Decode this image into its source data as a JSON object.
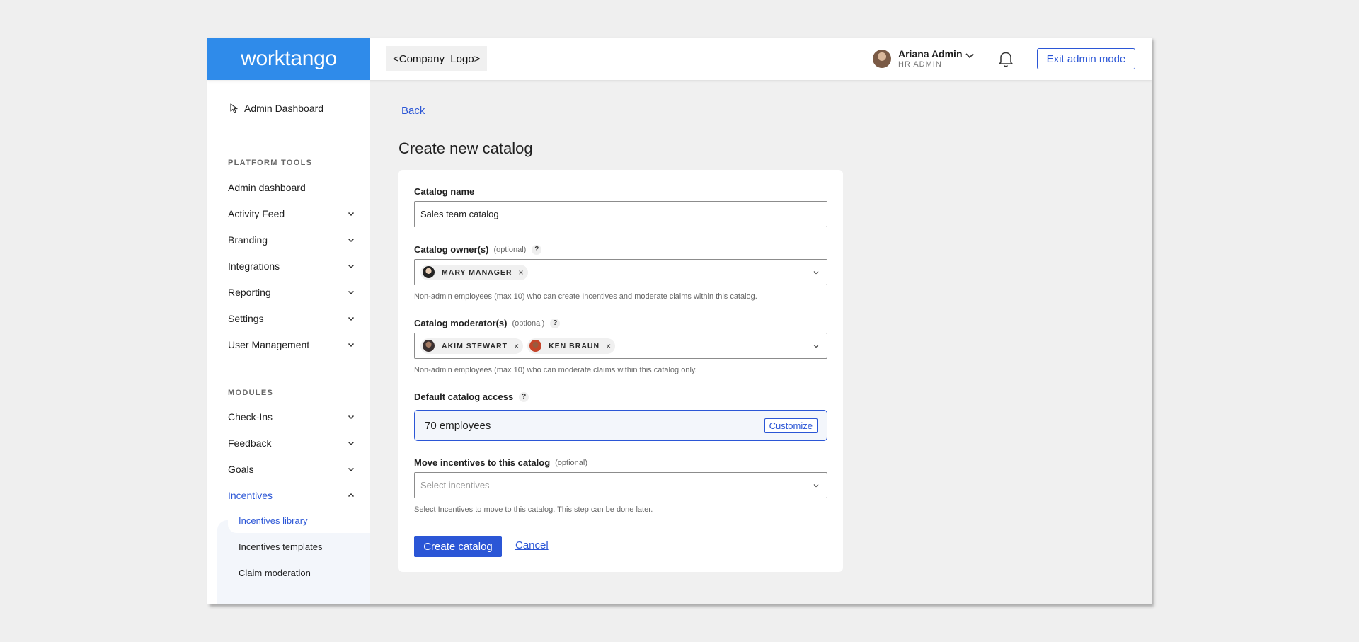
{
  "header": {
    "brand": "worktango",
    "company_logo": "<Company_Logo>",
    "user_name": "Ariana Admin",
    "user_role": "HR ADMIN",
    "exit_label": "Exit admin mode",
    "icons": {
      "user_menu": "chevron-down-icon",
      "notifications": "bell-icon"
    }
  },
  "sidebar": {
    "home": "Admin Dashboard",
    "home_icon": "pointer-icon",
    "section_platform": "PLATFORM TOOLS",
    "platform_items": [
      {
        "label": "Admin dashboard"
      },
      {
        "label": "Activity Feed"
      },
      {
        "label": "Branding"
      },
      {
        "label": "Integrations"
      },
      {
        "label": "Reporting"
      },
      {
        "label": "Settings"
      },
      {
        "label": "User Management"
      }
    ],
    "section_modules": "MODULES",
    "module_items": [
      {
        "label": "Check-Ins"
      },
      {
        "label": "Feedback"
      },
      {
        "label": "Goals"
      },
      {
        "label": "Incentives"
      }
    ],
    "incentive_subitems": [
      {
        "label": "Incentives library"
      },
      {
        "label": "Incentives templates"
      },
      {
        "label": "Claim moderation"
      }
    ],
    "accent_color": "#2b56d6"
  },
  "main": {
    "back": "Back",
    "title": "Create new catalog",
    "form": {
      "name_label": "Catalog name",
      "name_value": "Sales team catalog",
      "owners_label": "Catalog owner(s)",
      "owners_optional": "(optional)",
      "owners": [
        "MARY MANAGER"
      ],
      "owners_help": "Non-admin employees (max 10) who can create Incentives and moderate claims within this catalog.",
      "moderators_label": "Catalog moderator(s)",
      "moderators_optional": "(optional)",
      "moderators": [
        "AKIM STEWART",
        "KEN BRAUN"
      ],
      "moderators_help": "Non-admin employees (max 10) who can moderate claims within this catalog only.",
      "access_label": "Default catalog access",
      "access_value": "70 employees",
      "customize_label": "Customize",
      "move_label": "Move incentives to this catalog",
      "move_optional": "(optional)",
      "move_placeholder": "Select incentives",
      "move_help": "Select Incentives to move to this catalog. This step can be done later.",
      "create_label": "Create catalog",
      "cancel_label": "Cancel",
      "help_glyph": "?",
      "remove_glyph": "×"
    }
  },
  "colors": {
    "brand_blue": "#2f8bea",
    "primary": "#2b56d6",
    "page_bg": "#efefef"
  }
}
